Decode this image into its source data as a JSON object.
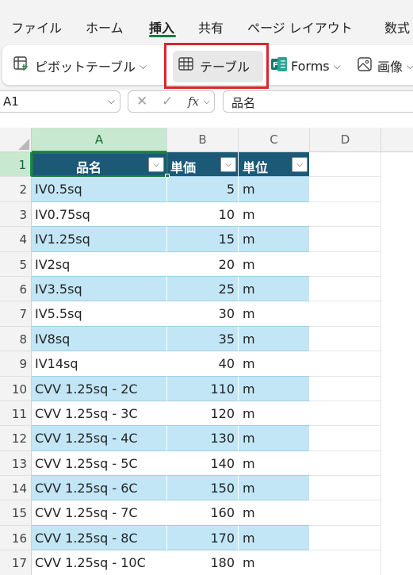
{
  "tabs": [
    {
      "label": "ファイル",
      "active": false
    },
    {
      "label": "ホーム",
      "active": false
    },
    {
      "label": "挿入",
      "active": true
    },
    {
      "label": "共有",
      "active": false
    },
    {
      "label": "ページ レイアウト",
      "active": false
    },
    {
      "label": "数式",
      "active": false
    }
  ],
  "ribbon": {
    "pivot_label": "ピボットテーブル",
    "table_label": "テーブル",
    "forms_label": "Forms",
    "image_label": "画像"
  },
  "formula_bar": {
    "name_box": "A1",
    "fx_label": "fx",
    "content": "品名"
  },
  "grid": {
    "columns": [
      "A",
      "B",
      "C",
      "D"
    ],
    "selected_column": "A",
    "table_header": [
      "品名",
      "単価",
      "単位"
    ],
    "rows": [
      {
        "num": "1"
      },
      {
        "num": "2",
        "name": "IV0.5sq",
        "price": "5",
        "unit": "m"
      },
      {
        "num": "3",
        "name": "IV0.75sq",
        "price": "10",
        "unit": "m"
      },
      {
        "num": "4",
        "name": "IV1.25sq",
        "price": "15",
        "unit": "m"
      },
      {
        "num": "5",
        "name": "IV2sq",
        "price": "20",
        "unit": "m"
      },
      {
        "num": "6",
        "name": "IV3.5sq",
        "price": "25",
        "unit": "m"
      },
      {
        "num": "7",
        "name": "IV5.5sq",
        "price": "30",
        "unit": "m"
      },
      {
        "num": "8",
        "name": "IV8sq",
        "price": "35",
        "unit": "m"
      },
      {
        "num": "9",
        "name": "IV14sq",
        "price": "40",
        "unit": "m"
      },
      {
        "num": "10",
        "name": "CVV 1.25sq - 2C",
        "price": "110",
        "unit": "m"
      },
      {
        "num": "11",
        "name": "CVV 1.25sq - 3C",
        "price": "120",
        "unit": "m"
      },
      {
        "num": "12",
        "name": "CVV 1.25sq - 4C",
        "price": "130",
        "unit": "m"
      },
      {
        "num": "13",
        "name": "CVV 1.25sq - 5C",
        "price": "140",
        "unit": "m"
      },
      {
        "num": "14",
        "name": "CVV 1.25sq - 6C",
        "price": "150",
        "unit": "m"
      },
      {
        "num": "15",
        "name": "CVV 1.25sq - 7C",
        "price": "160",
        "unit": "m"
      },
      {
        "num": "16",
        "name": "CVV 1.25sq - 8C",
        "price": "170",
        "unit": "m"
      },
      {
        "num": "17",
        "name": "CVV 1.25sq - 10C",
        "price": "180",
        "unit": "m"
      }
    ]
  },
  "colors": {
    "accent_green": "#1f7a42",
    "table_header": "#1b5977",
    "band_row": "#c2e6f5",
    "highlight_box": "#d9262b"
  },
  "icons": [
    "pivot-table-icon",
    "table-icon",
    "forms-icon",
    "image-icon",
    "cancel-icon",
    "check-icon",
    "chevron-down-icon",
    "filter-dropdown-icon"
  ]
}
